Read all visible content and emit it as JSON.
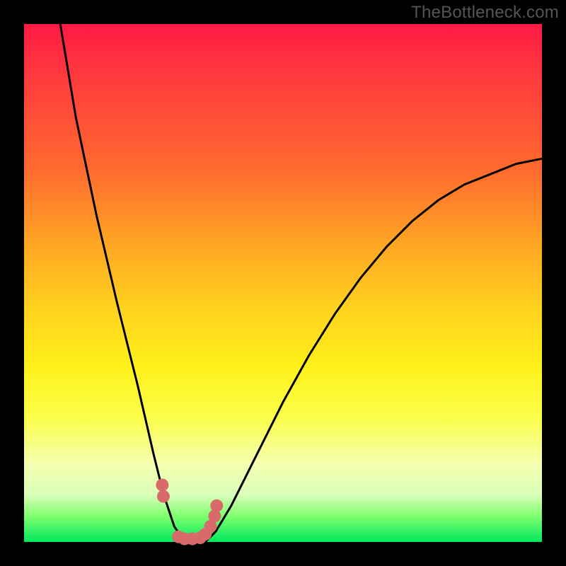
{
  "watermark": "TheBottleneck.com",
  "chart_data": {
    "type": "line",
    "title": "",
    "xlabel": "",
    "ylabel": "",
    "xlim": [
      0,
      100
    ],
    "ylim": [
      0,
      100
    ],
    "background_gradient": {
      "top_color": "#ff1a44",
      "bottom_color": "#00e85e",
      "meaning": "bottleneck severity (red high, green low)"
    },
    "series": [
      {
        "name": "bottleneck-curve",
        "x": [
          7,
          10,
          14,
          18,
          22,
          25,
          27,
          29,
          31,
          33,
          35,
          37,
          40,
          45,
          50,
          55,
          60,
          65,
          70,
          75,
          80,
          85,
          90,
          95,
          100
        ],
        "y": [
          100,
          82,
          63,
          46,
          30,
          17,
          9,
          3,
          0,
          0,
          0,
          2,
          7,
          17,
          27,
          36,
          44,
          51,
          57,
          62,
          66,
          69,
          71,
          73,
          74
        ]
      }
    ],
    "highlighted_points": {
      "name": "marked-range",
      "color": "#d86a6a",
      "x": [
        26.7,
        26.9,
        29.8,
        31.0,
        32.5,
        34.0,
        35.0,
        36.0,
        36.8,
        37.2
      ],
      "y": [
        11.0,
        8.8,
        1.0,
        0.6,
        0.6,
        0.8,
        1.5,
        3.0,
        5.0,
        7.0
      ]
    },
    "minimum": {
      "x": 32,
      "y": 0
    }
  }
}
